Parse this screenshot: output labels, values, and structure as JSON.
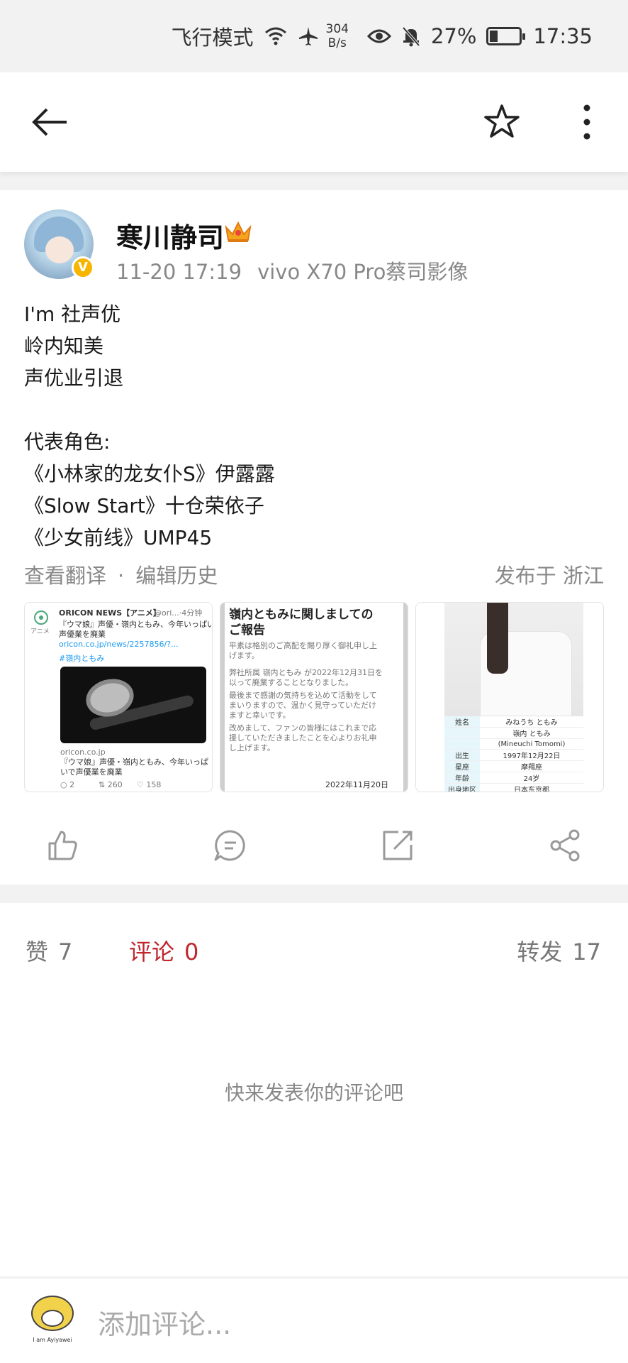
{
  "status_bar": {
    "airplane_mode": "飞行模式",
    "net_speed_value": "304",
    "net_speed_unit": "B/s",
    "battery": "27%",
    "battery_level": 0.27,
    "time": "17:35",
    "icons": [
      "wifi-icon",
      "airplane-icon",
      "eye-icon",
      "mute-bell-icon",
      "battery-icon"
    ]
  },
  "top_bar": {
    "icons": [
      "back-arrow-icon",
      "star-icon",
      "more-vertical-icon"
    ]
  },
  "post": {
    "author": "寒川静司",
    "verified_badge": "V",
    "date": "11-20 17:19",
    "device": "vivo X70 Pro蔡司影像",
    "text_lines": [
      "I'm 社声优",
      "岭内知美",
      "声优业引退",
      "",
      "代表角色:",
      "《小林家的龙女仆S》伊露露",
      "《Slow Start》十仓荣依子",
      "《少女前线》UMP45"
    ],
    "view_translation": "查看翻译",
    "separator": "·",
    "edit_history": "编辑历史",
    "location": "发布于 浙江",
    "images": {
      "img1": {
        "source": "ORICON NEWS【アニメ】",
        "handle": "@ori...·4分钟",
        "side_label": "アニメ",
        "line1": "『ウマ娘』声優・嶺内ともみ、今年いっぱいで",
        "line2": "声優業を廃業",
        "link": "oricon.co.jp/news/2257856/?...",
        "hashtag": "#嶺内ともみ",
        "domain": "oricon.co.jp",
        "card1": "『ウマ娘』声優・嶺内ともみ、今年いっぱ",
        "card2": "いで声優業を廃業",
        "replies": "2",
        "retweets": "260",
        "likes": "158"
      },
      "img2": {
        "title1": "嶺内ともみに関しましての",
        "title2": "ご報告",
        "lines": [
          "平素は格別のご高配を賜り厚く御礼申し上",
          "げます。",
          "",
          "弊社所属 嶺内ともみ が2022年12月31日を",
          "以って廃業することとなりました。",
          "最後まで感謝の気持ちを込めて活動をして",
          "まいりますので、温かく見守っていただけ",
          "ますと幸いです。",
          "改めまして、ファンの皆様にはこれまで応",
          "援していただきましたことを心よりお礼申",
          "し上げます。"
        ],
        "date": "2022年11月20日"
      },
      "img3": {
        "rows": [
          {
            "key": "姓名",
            "value": "みねうち ともみ"
          },
          {
            "key": "",
            "value": "嶺内 ともみ"
          },
          {
            "key": "",
            "value": "(Mineuchi Tomomi)"
          },
          {
            "key": "出生",
            "value": "1997年12月22日"
          },
          {
            "key": "星座",
            "value": "摩羯座"
          },
          {
            "key": "年龄",
            "value": "24岁"
          },
          {
            "key": "出身地区",
            "value": "日本东京都"
          }
        ]
      }
    },
    "actions": [
      "like-icon",
      "comment-icon",
      "share-out-icon",
      "share-icon"
    ]
  },
  "stats": {
    "likes_label": "赞",
    "likes_count": "7",
    "comments_label": "评论",
    "comments_count": "0",
    "reposts_label": "转发",
    "reposts_count": "17",
    "empty_hint": "快来发表你的评论吧",
    "active_color": "#c0272d"
  },
  "comment_bar": {
    "placeholder": "添加评论...",
    "avatar_caption": "I am Ayiyawei"
  }
}
